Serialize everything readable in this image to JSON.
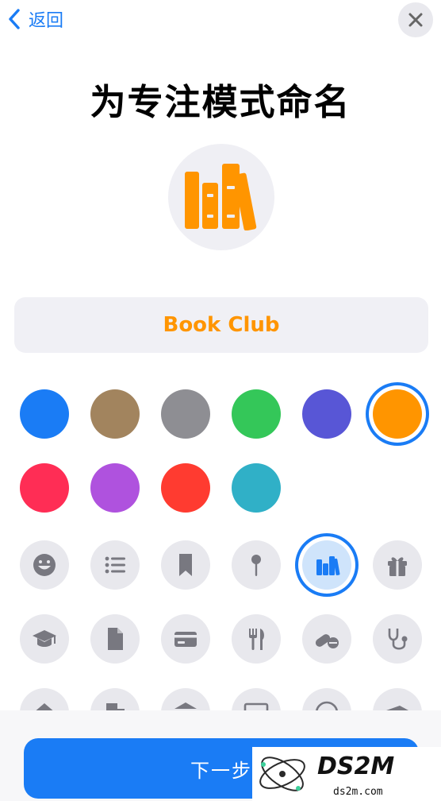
{
  "nav": {
    "back_label": "返回"
  },
  "title": "为专注模式命名",
  "focus_name": "Book Club",
  "accent": "#ff9500",
  "colors": [
    {
      "hex": "#1a7cf5",
      "selected": false
    },
    {
      "hex": "#a2845e",
      "selected": false
    },
    {
      "hex": "#8e8e93",
      "selected": false
    },
    {
      "hex": "#34c759",
      "selected": false
    },
    {
      "hex": "#5856d6",
      "selected": false
    },
    {
      "hex": "#ff9500",
      "selected": true
    },
    {
      "hex": "#ff2d55",
      "selected": false
    },
    {
      "hex": "#af52de",
      "selected": false
    },
    {
      "hex": "#ff3b30",
      "selected": false
    },
    {
      "hex": "#30b0c7",
      "selected": false
    }
  ],
  "icons": [
    {
      "name": "smiley-icon",
      "selected": false
    },
    {
      "name": "list-icon",
      "selected": false
    },
    {
      "name": "bookmark-icon",
      "selected": false
    },
    {
      "name": "pin-icon",
      "selected": false
    },
    {
      "name": "books-icon",
      "selected": true
    },
    {
      "name": "gift-icon",
      "selected": false
    },
    {
      "name": "graduation-cap-icon",
      "selected": false
    },
    {
      "name": "document-icon",
      "selected": false
    },
    {
      "name": "credit-card-icon",
      "selected": false
    },
    {
      "name": "fork-knife-icon",
      "selected": false
    },
    {
      "name": "pills-icon",
      "selected": false
    },
    {
      "name": "stethoscope-icon",
      "selected": false
    },
    {
      "name": "house-icon",
      "selected": false
    },
    {
      "name": "building-icon",
      "selected": false
    },
    {
      "name": "bank-icon",
      "selected": false
    },
    {
      "name": "monitor-icon",
      "selected": false
    },
    {
      "name": "globe-icon",
      "selected": false
    },
    {
      "name": "bed-icon",
      "selected": false
    }
  ],
  "next_button_label": "下一步",
  "watermark": {
    "logo": "DS2M",
    "url": "ds2m.com"
  }
}
